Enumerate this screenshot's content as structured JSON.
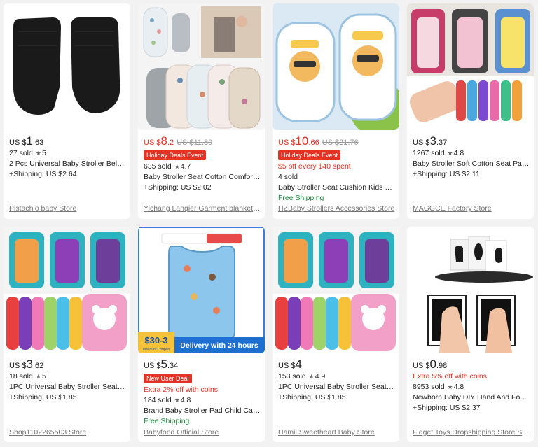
{
  "products": [
    {
      "currency": "US $",
      "price_int": "1",
      "price_dec": ".63",
      "old_price": "",
      "tag": "",
      "promo": "",
      "sold": "27 sold",
      "rating": "5",
      "title": "2 Pcs Universal Baby Stroller Belt C...",
      "shipping": "+Shipping: US $2.64",
      "free_shipping": "",
      "store": "Pistachio baby Store",
      "price_color": "#222222"
    },
    {
      "currency": "US $",
      "price_int": "8",
      "price_dec": ".2",
      "old_price": "US $11.89",
      "tag": "Holiday Deals Event",
      "promo": "",
      "sold": "635 sold",
      "rating": "4.7",
      "title": "Baby Stroller Seat Cotton Comfort...",
      "shipping": "+Shipping: US $2.02",
      "free_shipping": "",
      "store": "Yichang Lanqier Garment blankets...",
      "price_color": "#e43225"
    },
    {
      "currency": "US $",
      "price_int": "10",
      "price_dec": ".66",
      "old_price": "US $21.76",
      "tag": "Holiday Deals Event",
      "promo": "$5 off every $40 spent",
      "sold": "4 sold",
      "rating": "",
      "title": "Baby Stroller Seat Cushion Kids Co...",
      "shipping": "",
      "free_shipping": "Free Shipping",
      "store": "HZBaby Strollers Accessories Store",
      "price_color": "#e43225"
    },
    {
      "currency": "US $",
      "price_int": "3",
      "price_dec": ".37",
      "old_price": "",
      "tag": "",
      "promo": "",
      "sold": "1267 sold",
      "rating": "4.8",
      "title": "Baby Stroller Soft Cotton Seat Pad ...",
      "shipping": "+Shipping: US $2.11",
      "free_shipping": "",
      "store": "MAGGCE Factory Store",
      "price_color": "#222222"
    },
    {
      "currency": "US $",
      "price_int": "3",
      "price_dec": ".62",
      "old_price": "",
      "tag": "",
      "promo": "",
      "sold": "18 sold",
      "rating": "5",
      "title": "1PC Universal Baby Stroller Seat C...",
      "shipping": "+Shipping: US $1.85",
      "free_shipping": "",
      "store": "Shop1102265503 Store",
      "price_color": "#222222"
    },
    {
      "currency": "US $",
      "price_int": "5",
      "price_dec": ".34",
      "old_price": "",
      "tag": "New User Deal",
      "promo": "Extra 2% off with coins",
      "sold": "184 sold",
      "rating": "4.8",
      "title": "Brand Baby Stroller Pad Child Cart ...",
      "shipping": "",
      "free_shipping": "Free Shipping",
      "store": "Babyfond Official Store",
      "price_color": "#222222"
    },
    {
      "currency": "US $",
      "price_int": "4",
      "price_dec": "",
      "old_price": "",
      "tag": "",
      "promo": "",
      "sold": "153 sold",
      "rating": "4.9",
      "title": "1PC Universal Baby Stroller Seat C...",
      "shipping": "+Shipping: US $1.85",
      "free_shipping": "",
      "store": "Hamil Sweetheart Baby Store",
      "price_color": "#222222"
    },
    {
      "currency": "US $",
      "price_int": "0",
      "price_dec": ".98",
      "old_price": "",
      "tag": "",
      "promo": "Extra 5% off with coins",
      "sold": "8953 sold",
      "rating": "4.8",
      "title": "Newborn Baby DIY Hand And Foot...",
      "shipping": "+Shipping: US $2.37",
      "free_shipping": "",
      "store": "Fidget Toys Dropshipping Store St...",
      "price_color": "#222222"
    }
  ],
  "image_overlays": {
    "coupon_value": "$30-3",
    "coupon_sub": "Discount Coupon",
    "delivery_banner": "Delivery with 24 hours"
  }
}
